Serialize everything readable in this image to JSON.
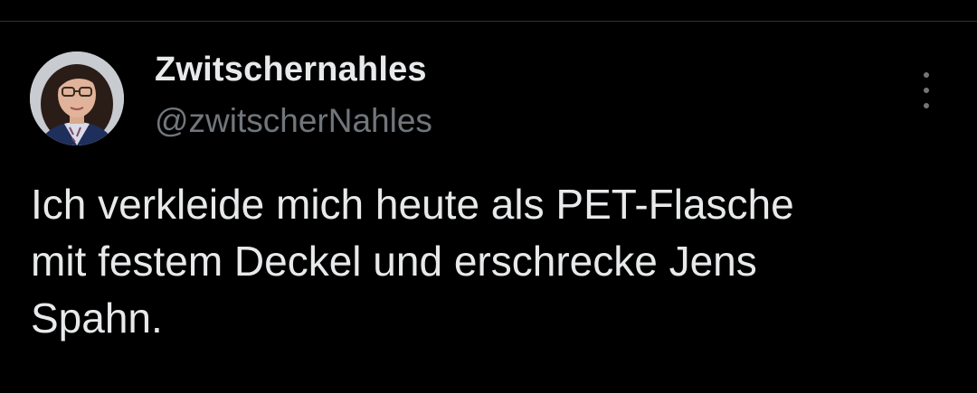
{
  "tweet": {
    "display_name": "Zwitschernahles",
    "handle": "@zwitscherNahles",
    "text": "Ich verkleide mich heute als PET-Flasche\nmit festem Deckel und erschrecke Jens\nSpahn.",
    "more_icon": "more-vertical-icon"
  },
  "colors": {
    "background": "#000000",
    "primary_text": "#e7e9ea",
    "secondary_text": "#71767b",
    "divider": "#2f3336"
  }
}
